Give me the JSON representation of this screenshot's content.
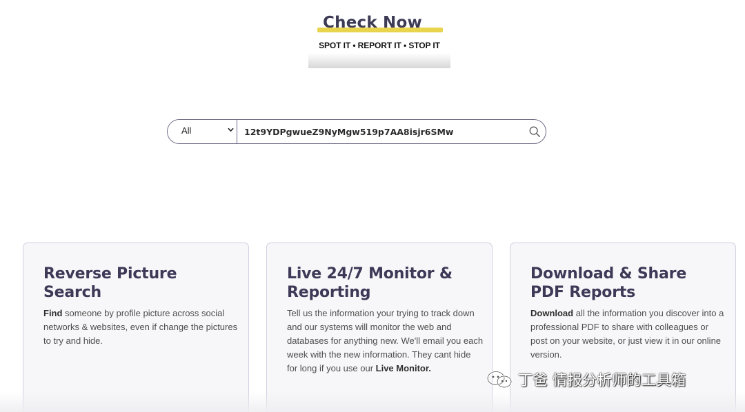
{
  "header": {
    "title": "Check Now",
    "tagline": "SPOT IT • REPORT IT • STOP IT"
  },
  "search": {
    "category": "All",
    "query": "12t9YDPgwueZ9NyMgw519p7AA8isjr6SMw"
  },
  "cards": [
    {
      "title_line1": "Reverse Picture",
      "title_line2": "Search",
      "body_bold": "Find",
      "body": " someone by profile picture across social networks & websites, even if change the pictures to try and hide."
    },
    {
      "title_line1": "Live 24/7 Monitor &",
      "title_line2": "Reporting",
      "body": "Tell us the information your trying to track down and our systems will monitor the web and databases for anything new. We'll email you each week with the new information. They cant hide for long if you use our ",
      "body_bold": "Live Monitor."
    },
    {
      "title_line1": "Download & Share",
      "title_line2": "PDF Reports",
      "body_bold": "Download",
      "body": " all the information you discover into a professional PDF to share with colleagues or post on your website, or just view it in our online version."
    }
  ],
  "watermark": {
    "text": "丁爸 情报分析师的工具箱",
    "icon": "wechat-icon"
  },
  "colors": {
    "accent_yellow": "#e8d44d",
    "heading": "#3d3957",
    "border": "#6f6a86",
    "card_bg": "#f7f7f9"
  }
}
